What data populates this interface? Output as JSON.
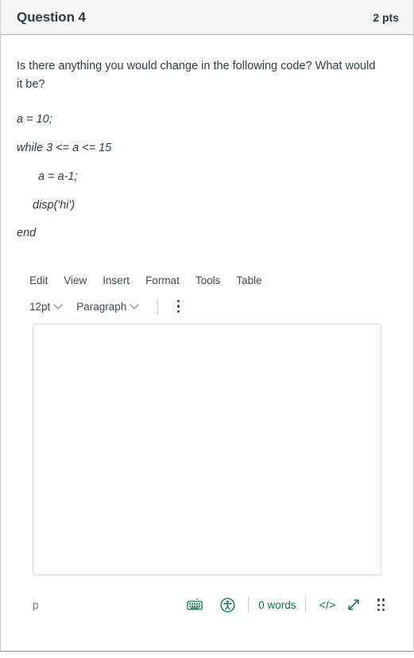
{
  "header": {
    "title": "Question 4",
    "points": "2 pts"
  },
  "question": {
    "prompt": "Is there anything you would change in the following code? What would it be?",
    "code_lines": [
      {
        "text": "a = 10;",
        "indent": 0
      },
      {
        "text": "while 3 <= a <= 15",
        "indent": 0
      },
      {
        "text": "a = a-1;",
        "indent": 1
      },
      {
        "text": "disp('hi')",
        "indent": 2
      },
      {
        "text": "end",
        "indent": 0
      }
    ]
  },
  "editor": {
    "menubar": [
      {
        "label": "Edit",
        "name": "menu-edit"
      },
      {
        "label": "View",
        "name": "menu-view"
      },
      {
        "label": "Insert",
        "name": "menu-insert"
      },
      {
        "label": "Format",
        "name": "menu-format"
      },
      {
        "label": "Tools",
        "name": "menu-tools"
      },
      {
        "label": "Table",
        "name": "menu-table"
      }
    ],
    "toolbar": {
      "font_size": "12pt",
      "block_format": "Paragraph",
      "more_options_label": "More toolbar options"
    },
    "content": "",
    "placeholder": "",
    "statusbar": {
      "element_path": "p",
      "word_count": "0 words",
      "code_toggle": "</>",
      "keyboard_icon": "keyboard-shortcuts-icon",
      "accessibility_icon": "accessibility-checker-icon",
      "resize_icon": "fullscreen-resize-icon",
      "drag_icon": "resize-drag-handle-icon"
    }
  },
  "colors": {
    "accent_green": "#0b734b",
    "text": "#2d3b45",
    "muted": "#6b7780",
    "border": "#c7cdd1",
    "header_bg": "#f5f5f5"
  }
}
